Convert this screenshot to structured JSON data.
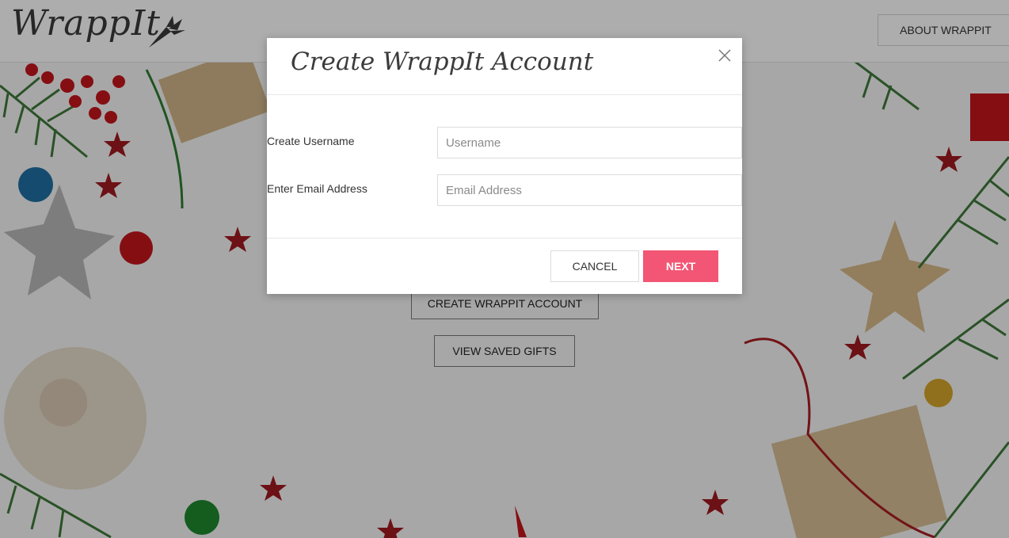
{
  "header": {
    "logo_text": "WrappIt",
    "about_label": "ABOUT WRAPPIT"
  },
  "page_buttons": {
    "create_account_label": "CREATE WRAPPIT ACCOUNT",
    "view_saved_label": "VIEW SAVED GIFTS"
  },
  "modal": {
    "title": "Create WrappIt Account",
    "username_label": "Create Username",
    "username_placeholder": "Username",
    "username_value": "",
    "email_label": "Enter Email Address",
    "email_placeholder": "Email Address",
    "email_value": "",
    "cancel_label": "CANCEL",
    "next_label": "NEXT"
  },
  "colors": {
    "accent": "#f25674",
    "carrot": "#3a3a3a"
  },
  "icons": {
    "logo": "carrot-icon",
    "close": "close-icon"
  }
}
